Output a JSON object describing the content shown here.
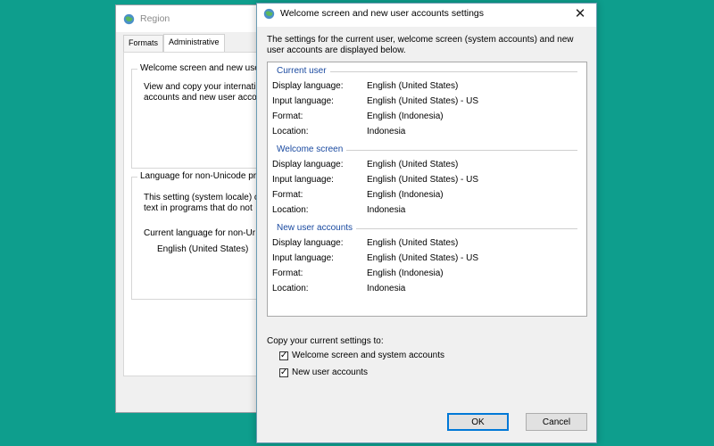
{
  "region_window": {
    "title": "Region",
    "tabs": [
      "Formats",
      "Administrative"
    ],
    "welcome_group": {
      "title": "Welcome screen and new user",
      "lines": [
        "View and copy your internati",
        "accounts and new user accou"
      ]
    },
    "unicode_group": {
      "title": "Language for non-Unicode pr",
      "lines": [
        "This setting (system locale) c",
        "text in programs that do not"
      ],
      "current_label": "Current language for non-Ur",
      "current_value": "English (United States)"
    }
  },
  "dialog": {
    "title": "Welcome screen and new user accounts settings",
    "intro": "The settings for the current user, welcome screen (system accounts) and new user accounts are displayed below.",
    "sections": [
      {
        "title": "Current user",
        "rows": [
          {
            "label": "Display language:",
            "value": "English (United States)"
          },
          {
            "label": "Input language:",
            "value": "English (United States) - US"
          },
          {
            "label": "Format:",
            "value": "English (Indonesia)"
          },
          {
            "label": "Location:",
            "value": "Indonesia"
          }
        ]
      },
      {
        "title": "Welcome screen",
        "rows": [
          {
            "label": "Display language:",
            "value": "English (United States)"
          },
          {
            "label": "Input language:",
            "value": "English (United States) - US"
          },
          {
            "label": "Format:",
            "value": "English (Indonesia)"
          },
          {
            "label": "Location:",
            "value": "Indonesia"
          }
        ]
      },
      {
        "title": "New user accounts",
        "rows": [
          {
            "label": "Display language:",
            "value": "English (United States)"
          },
          {
            "label": "Input language:",
            "value": "English (United States) - US"
          },
          {
            "label": "Format:",
            "value": "English (Indonesia)"
          },
          {
            "label": "Location:",
            "value": "Indonesia"
          }
        ]
      }
    ],
    "copy_label": "Copy your current settings to:",
    "checkboxes": [
      {
        "label": "Welcome screen and system accounts",
        "checked": true
      },
      {
        "label": "New user accounts",
        "checked": true
      }
    ],
    "ok_label": "OK",
    "cancel_label": "Cancel",
    "close_glyph": "✕"
  },
  "colors": {
    "desktop": "#0e9e8d",
    "section_title": "#1a4aa0",
    "ok_border": "#0078d7"
  }
}
